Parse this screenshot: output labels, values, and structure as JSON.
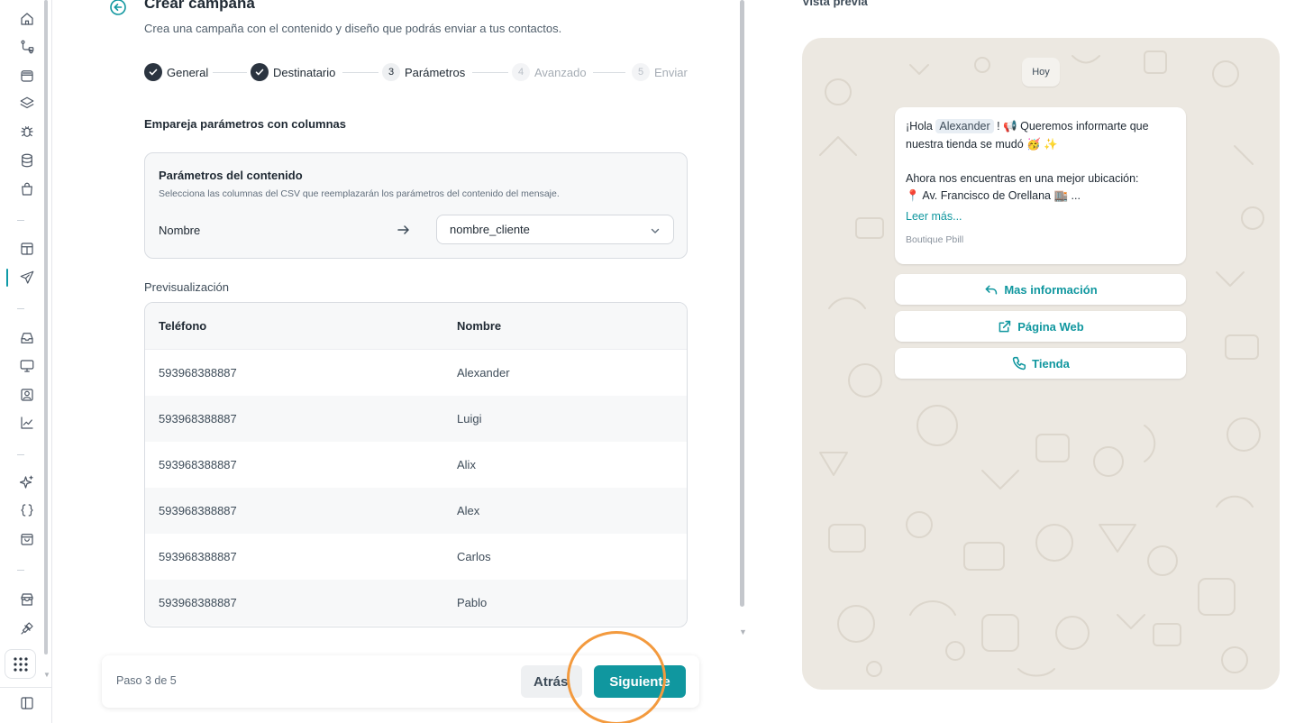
{
  "sidebar": {
    "icons": [
      "home-icon",
      "flow-icon",
      "archive-icon",
      "layers-icon",
      "bug-icon",
      "database-icon",
      "shopping-bag-icon",
      "layout-icon",
      "send-icon",
      "inbox-icon",
      "monitor-icon",
      "contact-icon",
      "chart-icon",
      "sparkles-icon",
      "braces-icon",
      "bag-icon",
      "store-icon",
      "plug-icon",
      "apps-grid-icon",
      "panel-icon"
    ],
    "active_item": "send-icon",
    "accent_color": "#0e9aa7"
  },
  "header": {
    "title": "Crear campaña",
    "subtitle": "Crea una campaña con el contenido y diseño que podrás enviar a tus contactos."
  },
  "stepper": {
    "steps": [
      {
        "number": "1",
        "label": "General",
        "status": "done"
      },
      {
        "number": "2",
        "label": "Destinatario",
        "status": "done"
      },
      {
        "number": "3",
        "label": "Parámetros",
        "status": "current"
      },
      {
        "number": "4",
        "label": "Avanzado",
        "status": "pending"
      },
      {
        "number": "5",
        "label": "Enviar",
        "status": "pending"
      }
    ]
  },
  "mapping": {
    "heading": "Empareja parámetros con columnas",
    "card_title": "Parámetros del contenido",
    "card_description": "Selecciona las columnas del CSV que reemplazarán los parámetros del contenido del mensaje.",
    "param_name": "Nombre",
    "selected_column": "nombre_cliente"
  },
  "preview_table": {
    "label": "Previsualización",
    "columns": [
      "Teléfono",
      "Nombre"
    ],
    "rows": [
      [
        "593968388887",
        "Alexander"
      ],
      [
        "593968388887",
        "Luigi"
      ],
      [
        "593968388887",
        "Alix"
      ],
      [
        "593968388887",
        "Alex"
      ],
      [
        "593968388887",
        "Carlos"
      ],
      [
        "593968388887",
        "Pablo"
      ]
    ]
  },
  "footer": {
    "step_count": "Paso 3 de 5",
    "back_label": "Atrás",
    "next_label": "Siguiente",
    "primary_color": "#10979f",
    "highlight_color": "#f39a3e"
  },
  "preview": {
    "title": "Vista previa",
    "date_chip": "Hoy",
    "message": {
      "greeting": "¡Hola",
      "variable": "Alexander",
      "line1_rest": "! 📢 Queremos informarte que",
      "line2": "nuestra tienda se mudó 🥳 ✨",
      "line3": "Ahora nos encuentras en una mejor ubicación:",
      "line4": "📍 Av. Francisco de Orellana 🏬 ...",
      "read_more": "Leer más...",
      "footer": "Boutique Pbill"
    },
    "buttons": [
      {
        "label": "Mas información",
        "icon": "reply-icon"
      },
      {
        "label": "Página Web",
        "icon": "external-link-icon"
      },
      {
        "label": "Tienda",
        "icon": "phone-icon"
      }
    ],
    "background_color": "#ece8e1"
  }
}
